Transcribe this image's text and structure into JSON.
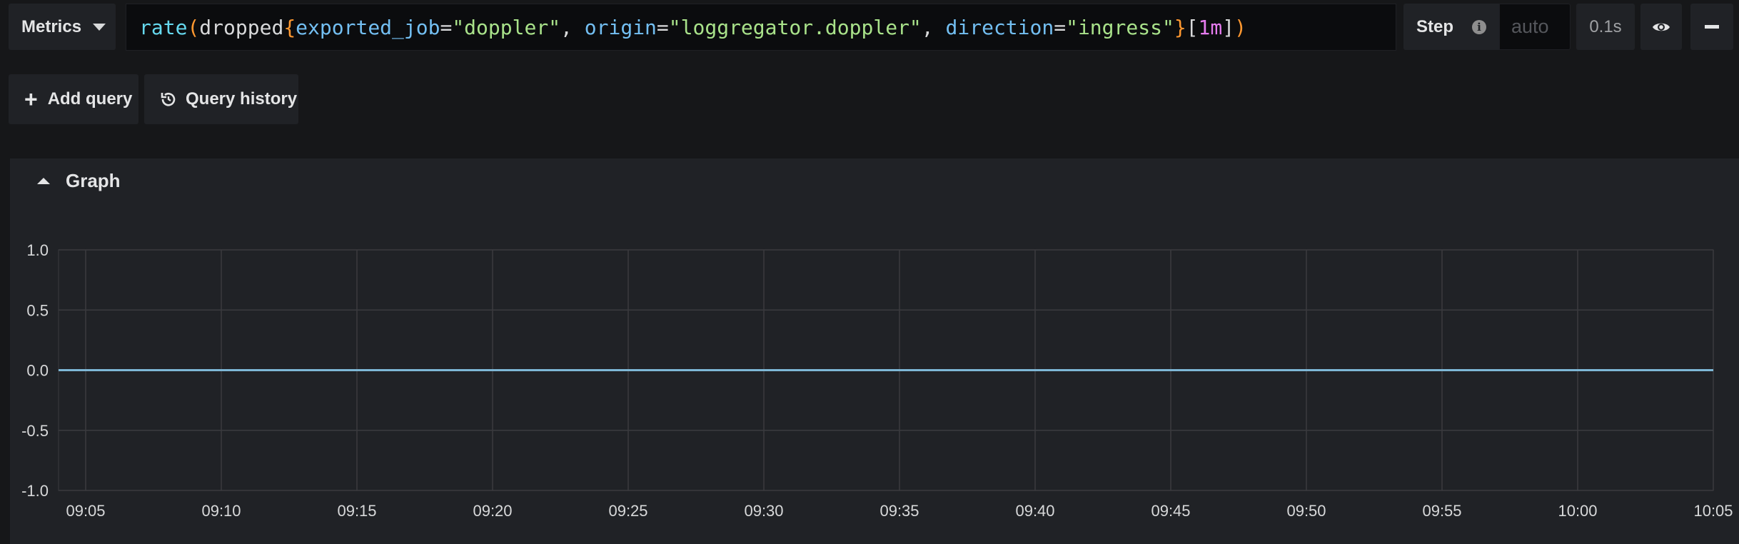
{
  "toolbar": {
    "metrics_label": "Metrics",
    "query_tokens": [
      {
        "t": "rate",
        "c": "t-fn"
      },
      {
        "t": "(",
        "c": "t-paren"
      },
      {
        "t": "dropped",
        "c": "t-metric"
      },
      {
        "t": "{",
        "c": "t-brace"
      },
      {
        "t": "exported_job",
        "c": "t-key2"
      },
      {
        "t": "=",
        "c": "t-plain"
      },
      {
        "t": "\"doppler\"",
        "c": "t-str"
      },
      {
        "t": ", ",
        "c": "t-plain"
      },
      {
        "t": "origin",
        "c": "t-key2"
      },
      {
        "t": "=",
        "c": "t-plain"
      },
      {
        "t": "\"loggregator.doppler\"",
        "c": "t-str"
      },
      {
        "t": ", ",
        "c": "t-plain"
      },
      {
        "t": "direction",
        "c": "t-key2"
      },
      {
        "t": "=",
        "c": "t-plain"
      },
      {
        "t": "\"ingress\"",
        "c": "t-str"
      },
      {
        "t": "}",
        "c": "t-brace"
      },
      {
        "t": "[",
        "c": "t-plain"
      },
      {
        "t": "1m",
        "c": "t-range"
      },
      {
        "t": "]",
        "c": "t-plain"
      },
      {
        "t": ")",
        "c": "t-paren"
      }
    ],
    "step_label": "Step",
    "step_placeholder": "auto",
    "timing": "0.1s",
    "eye_icon": "eye-icon",
    "minus_icon": "minus-icon"
  },
  "actions": {
    "add_query_label": "Add query",
    "query_history_label": "Query history"
  },
  "panel": {
    "title": "Graph"
  },
  "colors": {
    "series": "#7eb7d6",
    "grid": "#3a3b3f",
    "axis_text": "#d8d9da"
  },
  "chart_data": {
    "type": "line",
    "xlabel": "",
    "ylabel": "",
    "x_ticks": [
      "09:05",
      "09:10",
      "09:15",
      "09:20",
      "09:25",
      "09:30",
      "09:35",
      "09:40",
      "09:45",
      "09:50",
      "09:55",
      "10:00",
      "10:05"
    ],
    "y_ticks": [
      "1.0",
      "0.5",
      "0.0",
      "-0.5",
      "-1.0"
    ],
    "ylim": [
      -1.0,
      1.0
    ],
    "x_range": [
      "09:04",
      "10:05"
    ],
    "grid": true,
    "series": [
      {
        "x": [
          "09:04",
          "10:05"
        ],
        "y": [
          0.0,
          0.0
        ]
      }
    ]
  }
}
